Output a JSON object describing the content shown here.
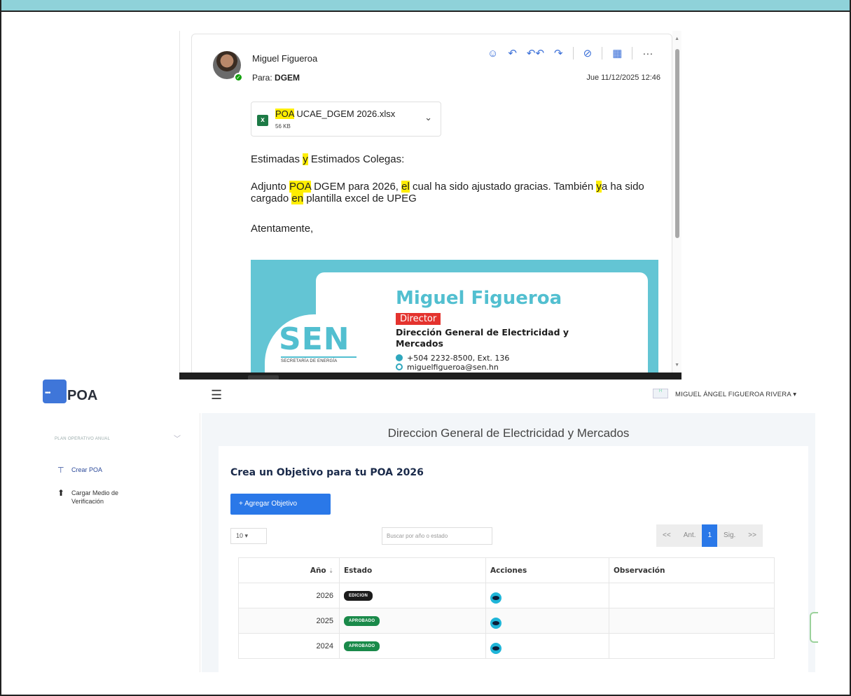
{
  "email": {
    "sender": "Miguel Figueroa",
    "to_label": "Para:",
    "to_value": "DGEM",
    "date": "Jue 11/12/2025 12:46",
    "actions": [
      "☺",
      "↶",
      "↶↶",
      "↷",
      "⊘",
      "▦",
      "···"
    ],
    "attachment": {
      "name_hl": "POA",
      "name_rest": " UCAE_DGEM 2026.xlsx",
      "size": "56 KB",
      "icon": "x"
    },
    "body": {
      "greeting_a": "Estimadas ",
      "greeting_hl": "y",
      "greeting_b": " Estimados Colegas:",
      "p_a": "Adjunto ",
      "p_hl1": "POA",
      "p_b": " DGEM para 2026, ",
      "p_hl2": "el",
      "p_c": " cual ha sido ajustado gracias. También ",
      "p_hl3": "y",
      "p_d": "a ha sido cargado ",
      "p_hl4": "en",
      "p_e": " plantilla excel de UPEG",
      "closing": "Atentamente,"
    },
    "signature": {
      "logo": "SEN",
      "logo_sub": "SECRETARÍA DE ENERGÍA",
      "name": "Miguel Figueroa",
      "role": "Director",
      "org": "Dirección General de Electricidad y Mercados",
      "phone": "+504 2232-8500, Ext. 136",
      "email": "miguelfigueroa@sen.hn"
    }
  },
  "app": {
    "logo_text": "POA",
    "user_name": "MIGUEL ÁNGEL FIGUEROA RIVERA ▾",
    "sidebar": {
      "section": "PLAN OPERATIVO ANUAL",
      "items": [
        {
          "label": "Crear POA",
          "icon": "⊤"
        },
        {
          "label": "Cargar Medio de Verificación",
          "icon": "⬆"
        }
      ]
    },
    "page_title": "Direccion General de Electricidad y Mercados",
    "panel": {
      "title": "Crea un Objetivo para tu POA 2026",
      "add_button": "+ Agregar Objetivo",
      "per_page": "10  ▾",
      "search_placeholder": "Buscar por año o estado",
      "pager": [
        "<<",
        "Ant.",
        "1",
        "Sig.",
        ">>"
      ],
      "columns": [
        "Año",
        "Estado",
        "Acciones",
        "Observación"
      ],
      "rows": [
        {
          "year": "2026",
          "status": "EDICION",
          "status_color": "#1b1b1b"
        },
        {
          "year": "2025",
          "status": "APROBADO",
          "status_color": "#1a8a4a"
        },
        {
          "year": "2024",
          "status": "APROBADO",
          "status_color": "#1a8a4a"
        }
      ]
    }
  }
}
